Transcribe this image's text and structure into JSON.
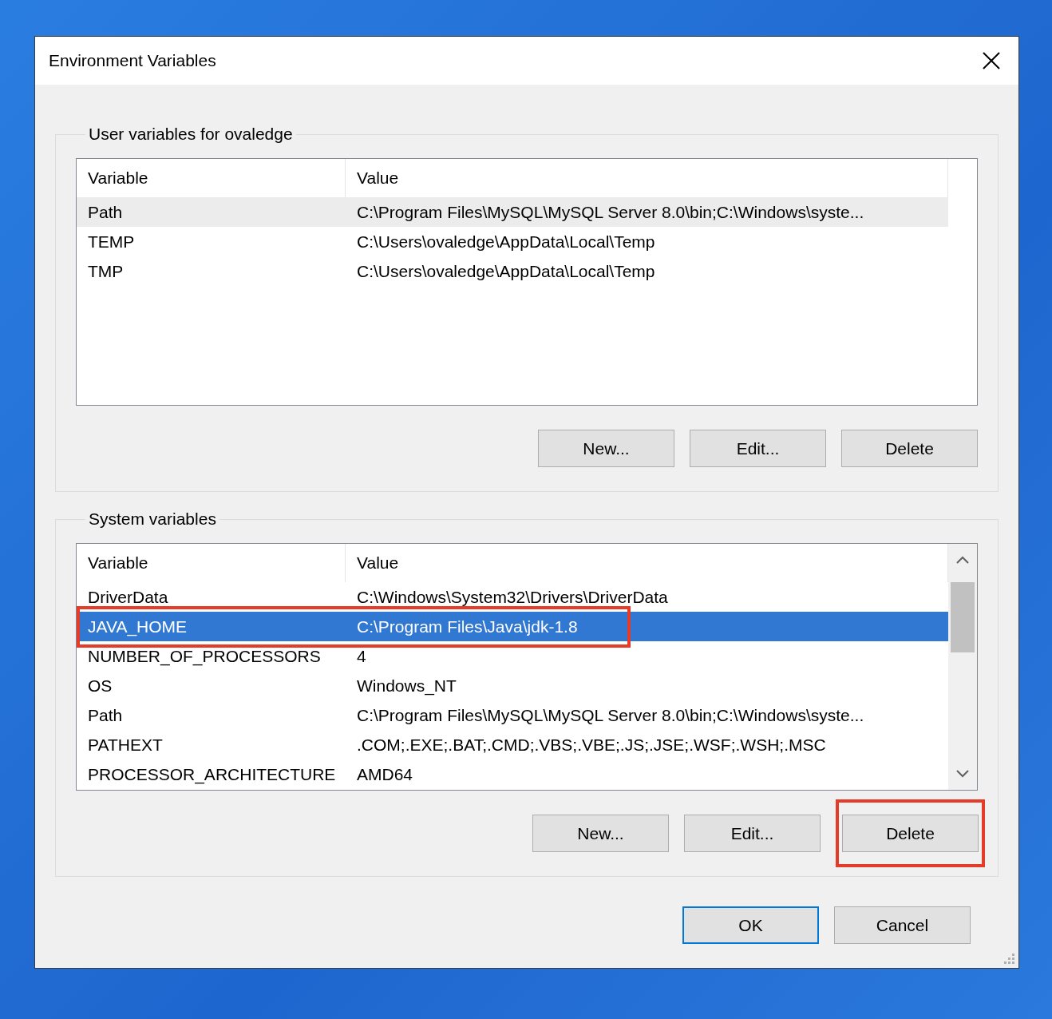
{
  "window": {
    "title": "Environment Variables"
  },
  "user_variables": {
    "label": "User variables for ovaledge",
    "focused": false,
    "scrollbar": false,
    "columns": [
      "Variable",
      "Value"
    ],
    "rows": [
      {
        "variable": "Path",
        "value": "C:\\Program Files\\MySQL\\MySQL Server 8.0\\bin;C:\\Windows\\syste...",
        "selected": true,
        "highlighted": false
      },
      {
        "variable": "TEMP",
        "value": "C:\\Users\\ovaledge\\AppData\\Local\\Temp",
        "selected": false,
        "highlighted": false
      },
      {
        "variable": "TMP",
        "value": "C:\\Users\\ovaledge\\AppData\\Local\\Temp",
        "selected": false,
        "highlighted": false
      }
    ],
    "buttons": [
      {
        "label": "New...",
        "highlighted": false
      },
      {
        "label": "Edit...",
        "highlighted": false
      },
      {
        "label": "Delete",
        "highlighted": false
      }
    ]
  },
  "system_variables": {
    "label": "System variables",
    "focused": true,
    "scrollbar": true,
    "columns": [
      "Variable",
      "Value"
    ],
    "rows": [
      {
        "variable": "DriverData",
        "value": "C:\\Windows\\System32\\Drivers\\DriverData",
        "selected": false,
        "highlighted": false
      },
      {
        "variable": "JAVA_HOME",
        "value": "C:\\Program Files\\Java\\jdk-1.8",
        "selected": true,
        "highlighted": true
      },
      {
        "variable": "NUMBER_OF_PROCESSORS",
        "value": "4",
        "selected": false,
        "highlighted": false
      },
      {
        "variable": "OS",
        "value": "Windows_NT",
        "selected": false,
        "highlighted": false
      },
      {
        "variable": "Path",
        "value": "C:\\Program Files\\MySQL\\MySQL Server 8.0\\bin;C:\\Windows\\syste...",
        "selected": false,
        "highlighted": false
      },
      {
        "variable": "PATHEXT",
        "value": ".COM;.EXE;.BAT;.CMD;.VBS;.VBE;.JS;.JSE;.WSF;.WSH;.MSC",
        "selected": false,
        "highlighted": false
      },
      {
        "variable": "PROCESSOR_ARCHITECTURE",
        "value": "AMD64",
        "selected": false,
        "highlighted": false
      }
    ],
    "buttons": [
      {
        "label": "New...",
        "highlighted": false
      },
      {
        "label": "Edit...",
        "highlighted": false
      },
      {
        "label": "Delete",
        "highlighted": true
      }
    ]
  },
  "buttons": [
    {
      "label": "OK",
      "default": true
    },
    {
      "label": "Cancel",
      "default": false
    }
  ]
}
